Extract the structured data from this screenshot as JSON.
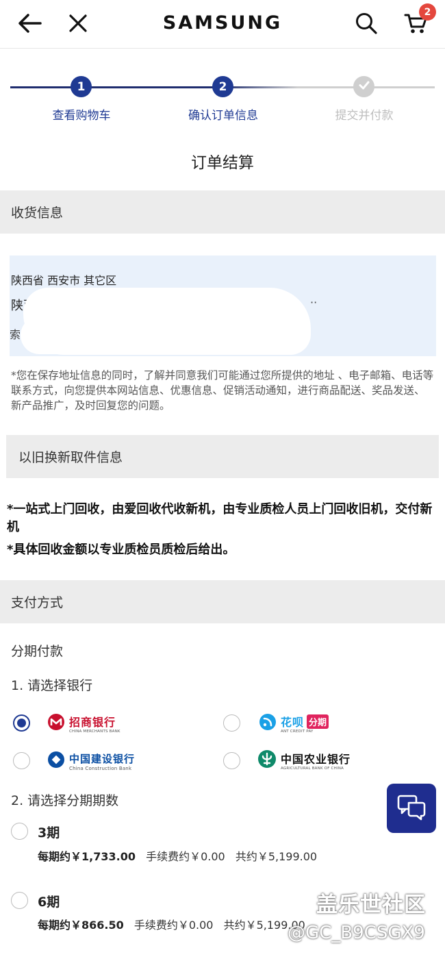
{
  "header": {
    "logo": "SAMSUNG",
    "cart_count": "2",
    "icons": [
      "back-arrow-icon",
      "close-icon",
      "search-icon",
      "cart-icon"
    ]
  },
  "steps": [
    {
      "number": "1",
      "label": "查看购物车",
      "state": "done"
    },
    {
      "number": "2",
      "label": "确认订单信息",
      "state": "current"
    },
    {
      "number": "",
      "label": "提交并付款",
      "state": "pending"
    }
  ],
  "page_title": "订单结算",
  "shipping": {
    "section_title": "收货信息",
    "address_region": "陕西省 西安市 其它区",
    "address_detail_start": "陕西",
    "address_detail_end": "··",
    "address_third_start": "索",
    "notice": "*您在保存地址信息的同时，了解并同意我们可能通过您所提供的地址 、电子邮箱、电话等联系方式，向您提供本网站信息、优惠信息、促销活动通知，进行商品配送、奖品发送、新产品推广，及时回复您的问题。"
  },
  "trade_in": {
    "section_title": "以旧换新取件信息",
    "note1": "*一站式上门回收，由爱回收代收新机，由专业质检人员上门回收旧机，交付新机",
    "note2": "*具体回收金额以专业质检员质检后给出。"
  },
  "payment": {
    "section_title": "支付方式",
    "method": "分期付款",
    "step1_label": "1. 请选择银行",
    "banks": [
      {
        "name": "招商银行",
        "sub": "CHINA MERCHANTS BANK",
        "selected": true,
        "color": "#c8102e"
      },
      {
        "name": "花呗",
        "tag": "分期",
        "sub": "ANT CREDIT PAY",
        "selected": false,
        "color": "#1aa0e6"
      },
      {
        "name": "中国建设银行",
        "sub": "China Construction Bank",
        "selected": false,
        "color": "#0b4fa3"
      },
      {
        "name": "中国农业银行",
        "sub": "AGRICULTURAL BANK OF CHINA",
        "selected": false,
        "color": "#0f8a6a"
      }
    ],
    "step2_label": "2. 请选择分期期数",
    "periods": [
      {
        "title": "3期",
        "per_label": "每期约",
        "per_amount": "￥1,733.00",
        "fee": "手续费约￥0.00",
        "total": "共约￥5,199.00",
        "selected": false
      },
      {
        "title": "6期",
        "per_label": "每期约",
        "per_amount": "￥866.50",
        "fee": "手续费约￥0.00",
        "total": "共约￥5,199.00",
        "selected": false
      }
    ]
  },
  "watermark": {
    "line1": "盖乐世社区",
    "line2": "@GC_B9CSGX9"
  },
  "colors": {
    "accent": "#1f3a93",
    "step_pending": "#cfcfcf",
    "badge": "#e4473d",
    "section_bg": "#ececec",
    "address_bg": "#e9f1fb"
  }
}
